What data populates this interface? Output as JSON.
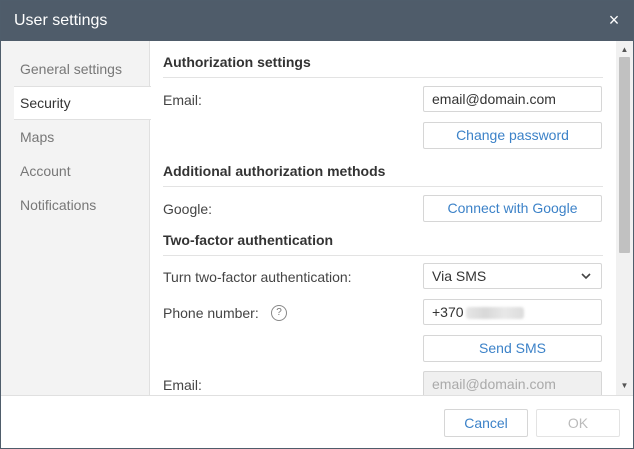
{
  "dialog": {
    "title": "User settings",
    "close_symbol": "×"
  },
  "sidebar": {
    "items": [
      {
        "label": "General settings",
        "active": false
      },
      {
        "label": "Security",
        "active": true
      },
      {
        "label": "Maps",
        "active": false
      },
      {
        "label": "Account",
        "active": false
      },
      {
        "label": "Notifications",
        "active": false
      }
    ]
  },
  "auth": {
    "title": "Authorization settings",
    "email_label": "Email:",
    "email_value": "email@domain.com",
    "change_password_label": "Change password"
  },
  "additional": {
    "title": "Additional authorization methods",
    "google_label": "Google:",
    "connect_google_label": "Connect with Google"
  },
  "two_factor": {
    "title": "Two-factor authentication",
    "turn_label": "Turn two-factor authentication:",
    "method_value": "Via SMS",
    "phone_label": "Phone number:",
    "help_symbol": "?",
    "phone_value": "+370",
    "send_sms_label": "Send SMS",
    "email_label": "Email:",
    "email_placeholder": "email@domain.com"
  },
  "footer": {
    "cancel_label": "Cancel",
    "ok_label": "OK"
  },
  "colors": {
    "titlebar": "#4f5c6a",
    "link": "#3c82c8"
  }
}
